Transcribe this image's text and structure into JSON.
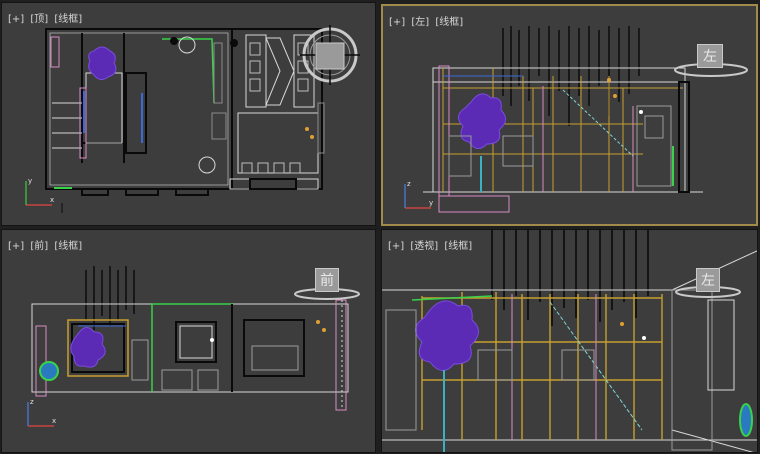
{
  "viewports": {
    "top": {
      "labels": [
        "[+]",
        "[顶]",
        "[线框]"
      ],
      "viewcube_text": ""
    },
    "left": {
      "labels": [
        "[+]",
        "[左]",
        "[线框]"
      ],
      "viewcube_text": "左"
    },
    "front": {
      "labels": [
        "[+]",
        "[前]",
        "[线框]"
      ],
      "viewcube_text": "前"
    },
    "perspective": {
      "labels": [
        "[+]",
        "[透视]",
        "[线框]"
      ],
      "viewcube_text": "左"
    }
  },
  "axes": {
    "x": "x",
    "y": "y",
    "z": "z"
  },
  "colors": {
    "viewport_bg": "#3d3d3d",
    "active_border": "#a08b4a",
    "wire_white": "#d8d8d8",
    "wire_black": "#0a0a0a",
    "plant_purple": "#5b2bb5",
    "wire_yellow": "#c8a030",
    "wire_pink": "#d98cc8",
    "wire_green": "#3ad24a",
    "wire_blue": "#3b6ad8",
    "wire_cyan": "#7fd6d6"
  }
}
